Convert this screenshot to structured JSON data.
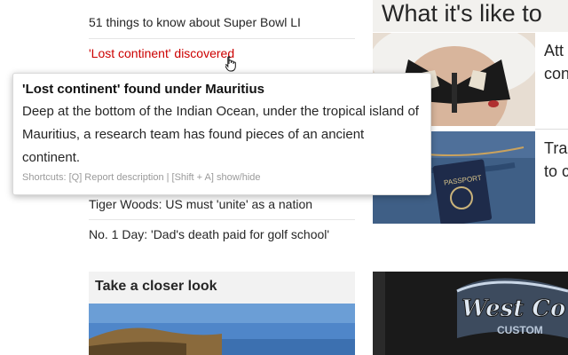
{
  "headlines": {
    "items": [
      "51 things to know about Super Bowl LI",
      "'Lost continent' discovered",
      "Tiger Woods: US must 'unite' as a nation",
      "No. 1 Day: 'Dad's death paid for golf school'"
    ]
  },
  "feature": {
    "title": "What it's like to",
    "cards": [
      {
        "text_lines": [
          "Att",
          "con"
        ]
      },
      {
        "text_lines": [
          "Tra",
          "to c"
        ]
      }
    ]
  },
  "passport_label": "PASSPORT",
  "closer_look": {
    "title": "Take a closer look"
  },
  "brand_logo_text": "West Coast Customs",
  "tooltip": {
    "title": "'Lost continent' found under Mauritius",
    "description": "Deep at the bottom of the Indian Ocean, under the tropical island of Mauritius, a research team has found pieces of an ancient continent.",
    "shortcuts": "Shortcuts: [Q] Report description | [Shift + A] show/hide"
  },
  "colors": {
    "active_link": "#cc0000",
    "title_band": "#f2f1ee"
  }
}
